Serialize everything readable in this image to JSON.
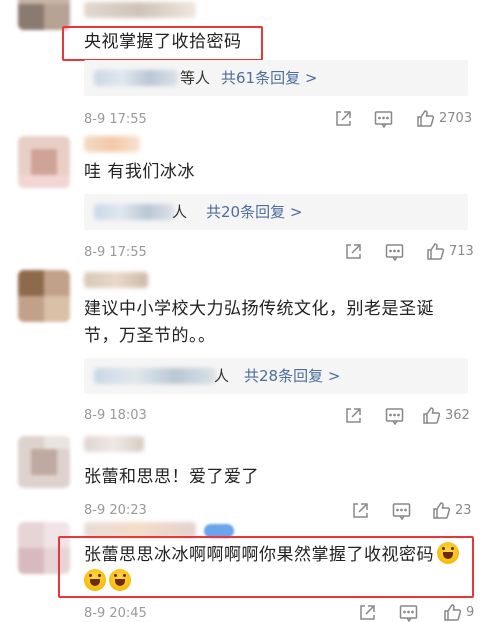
{
  "comments": [
    {
      "text_lines": [
        "央视掌握了收拾密码"
      ],
      "reply_people": "等人",
      "reply_count": "共61条回复 >",
      "time": "8-9 17:55",
      "likes": "2703",
      "highlighted": true
    },
    {
      "text_lines": [
        "哇 有我们冰冰"
      ],
      "reply_people": "人",
      "reply_count": "共20条回复 >",
      "time": "8-9 17:55",
      "likes": "713",
      "highlighted": false
    },
    {
      "text_lines": [
        "建议中小学校大力弘扬传统文化，别老是圣诞",
        "节，万圣节的。。"
      ],
      "reply_people": "人",
      "reply_count": "共28条回复 >",
      "time": "8-9 18:03",
      "likes": "362",
      "highlighted": false
    },
    {
      "text_lines": [
        "张蕾和思思！爱了爱了"
      ],
      "time": "8-9 20:23",
      "likes": "23",
      "highlighted": false
    },
    {
      "text_lines": [
        "张蕾思思冰冰啊啊啊啊你果然掌握了收视密码"
      ],
      "time": "8-9 20:45",
      "likes": "9",
      "highlighted": true
    }
  ],
  "icons": {
    "share": "share-icon",
    "comment": "comment-icon",
    "like": "thumbs-up-icon",
    "emoji": "laughing-face-emoji"
  },
  "colors": {
    "highlight_border": "#e8373b",
    "reply_count_link": "#4c6e9c",
    "timestamp": "#999999",
    "reply_background": "#f5f5f5"
  }
}
